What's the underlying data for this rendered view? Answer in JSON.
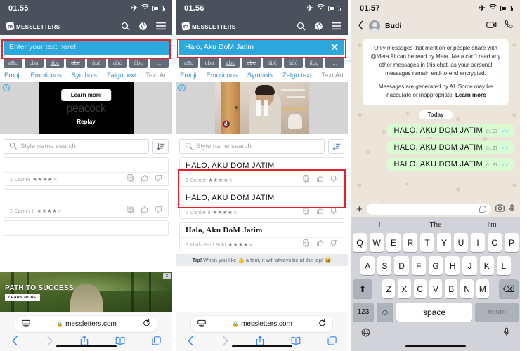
{
  "panel1": {
    "status": {
      "time": "01.55",
      "airplane_icon": "airplane-icon",
      "wifi_icon": "wifi-icon",
      "battery_icon": "battery-icon"
    },
    "header": {
      "logo": "messletters",
      "search_icon": "search-icon",
      "globe_icon": "globe-icon",
      "menu_icon": "hamburger-menu-icon"
    },
    "text_input": {
      "placeholder": "Enter your text here!",
      "value": ""
    },
    "chips": [
      "aBc",
      "cba",
      "abc",
      "abc",
      "ábč",
      "ȧḃċ",
      "ẩḅç",
      "..."
    ],
    "links": [
      "Emoji",
      "Emoticons",
      "Symbols",
      "Zalgo text",
      "Text Art"
    ],
    "ad": {
      "label": "info-icon",
      "learn_more": "Learn more",
      "brand": "peacock",
      "replay": "Replay"
    },
    "search": {
      "placeholder": "Style name search",
      "sort_icon": "sort-icon"
    },
    "cards": [
      {
        "preview": "",
        "meta": "1 Carrier",
        "stars": 4.5
      },
      {
        "preview": "",
        "meta": "2 Carrier II",
        "stars": 4
      }
    ],
    "banner": {
      "title": "PATH TO SUCCESS",
      "cta": "LEARN MORE",
      "close": "×"
    },
    "safari": {
      "url": "messletters.com",
      "lock_icon": "lock-icon",
      "reader_icon": "reader-view-icon",
      "reload_icon": "reload-icon",
      "back_icon": "back-chevron-icon",
      "forward_icon": "forward-chevron-icon",
      "share_icon": "share-icon",
      "bookmarks_icon": "bookmarks-icon",
      "tabs_icon": "tabs-icon"
    }
  },
  "panel2": {
    "status": {
      "time": "01.56"
    },
    "header": {
      "logo": "messletters"
    },
    "text_input": {
      "value": "Halo, Aku DoM Jatim",
      "clear": "✕"
    },
    "chips": [
      "aBc",
      "cba",
      "abc",
      "abc",
      "ábč",
      "ȧḃċ",
      "ẩḅç",
      "..."
    ],
    "links": [
      "Emoji",
      "Emoticons",
      "Symbols",
      "Zalgo text",
      "Text Art"
    ],
    "search": {
      "placeholder": "Style name search"
    },
    "cards": [
      {
        "preview": "HALO, AKU DOM JATIM",
        "meta": "1 Carrier",
        "stars": 4.5,
        "serif": false
      },
      {
        "preview": "HALO, AKU DOM JATIM",
        "meta": "2 Carrier II",
        "stars": 4,
        "serif": false
      },
      {
        "preview": "Halo, Aku DoM Jatim",
        "meta": "3 Math Serif Bold",
        "stars": 4,
        "serif": true
      }
    ],
    "tip": {
      "prefix": "Tip!",
      "text": "When you like 👍 a font, it will always be at the top! 😄"
    },
    "safari": {
      "url": "messletters.com"
    }
  },
  "panel3": {
    "status": {
      "time": "01.57"
    },
    "header": {
      "contact": "Budi",
      "back_icon": "back-chevron-icon",
      "video_icon": "video-call-icon",
      "call_icon": "voice-call-icon"
    },
    "notice": {
      "line1": "Only messages that mention or people share with @Meta AI can be read by Meta. Meta can't read any other messages in this chat, as your personal messages remain end-to-end encrypted.",
      "line2_prefix": "Messages are generated by AI. Some may be inaccurate or inappropriate. ",
      "line2_link": "Learn more"
    },
    "day_divider": "Today",
    "messages": [
      {
        "text": "HALO, AKU DOM JATIM",
        "time": "01.57",
        "ticks": "✓✓"
      },
      {
        "text": "HALO, AKU DOM JATIM",
        "time": "01.57",
        "ticks": "✓✓"
      },
      {
        "text": "HALO, AKU DOM JATIM",
        "time": "01.57",
        "ticks": "✓✓"
      }
    ],
    "composer": {
      "plus_icon": "plus-icon",
      "value": "",
      "sticker_icon": "sticker-icon",
      "camera_icon": "camera-icon",
      "mic_icon": "microphone-icon"
    },
    "keyboard": {
      "suggestions": [
        "I",
        "The",
        "I'm"
      ],
      "row1": [
        "Q",
        "W",
        "E",
        "R",
        "T",
        "Y",
        "U",
        "I",
        "O",
        "P"
      ],
      "row2": [
        "A",
        "S",
        "D",
        "F",
        "G",
        "H",
        "J",
        "K",
        "L"
      ],
      "row3": [
        "Z",
        "X",
        "C",
        "V",
        "B",
        "N",
        "M"
      ],
      "shift": "⬆",
      "backspace": "⌫",
      "numbers": "123",
      "emoji": "☺",
      "space": "space",
      "return": "return",
      "globe_icon": "globe-icon",
      "mic_icon": "microphone-icon"
    }
  },
  "colors": {
    "header_dark": "#4a505c",
    "input_blue": "#2ca8dd",
    "link_blue": "#2f8ed6",
    "highlight_red": "#e8202a",
    "wa_bubble": "#d9fdd3",
    "wa_bg": "#ede4da",
    "safari_blue": "#3a83f7"
  }
}
